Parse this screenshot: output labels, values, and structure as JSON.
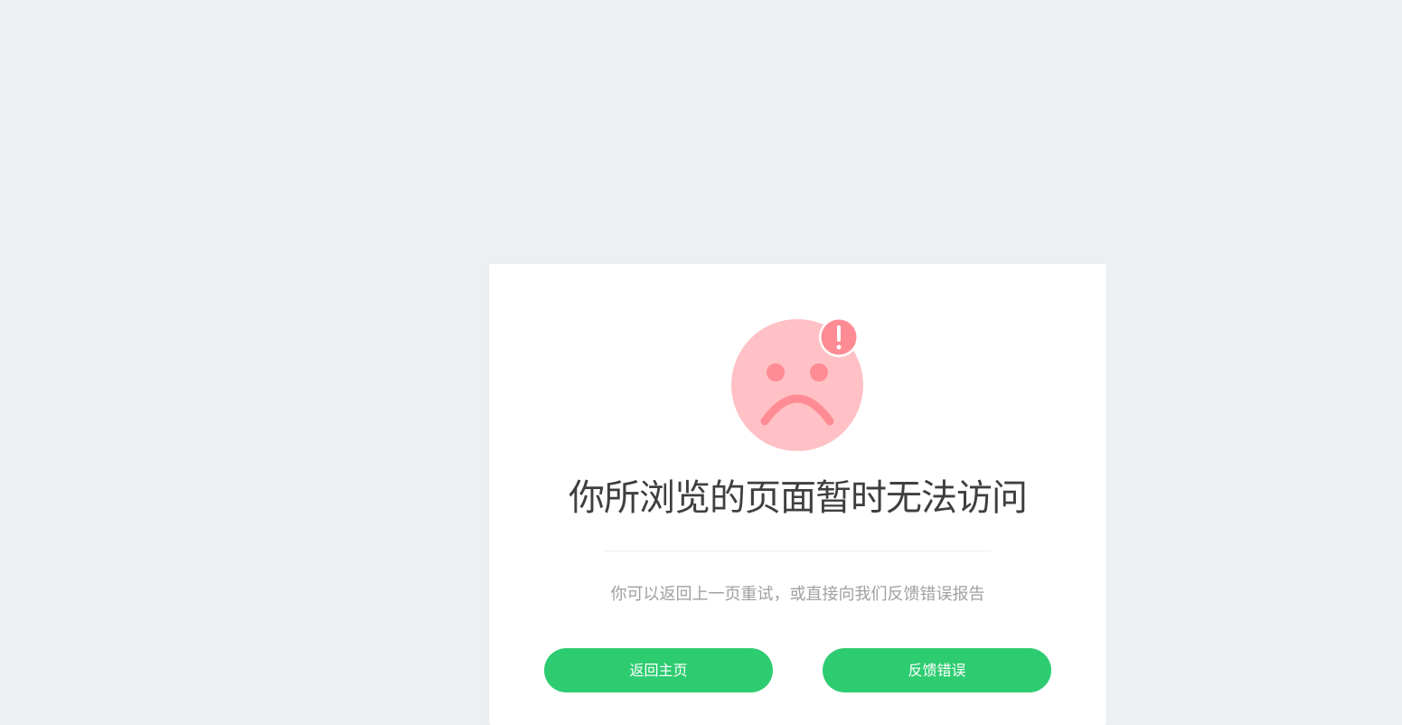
{
  "error": {
    "title": "你所浏览的页面暂时无法访问",
    "subtitle": "你可以返回上一页重试，或直接向我们反馈错误报告",
    "icon": "sad-face-icon",
    "badge_icon": "exclamation-icon"
  },
  "actions": {
    "home_label": "返回主页",
    "feedback_label": "反馈错误"
  },
  "colors": {
    "background": "#ecf0f3",
    "face": "#ffc1c5",
    "face_features": "#ff8c94",
    "badge": "#ff8c94",
    "button": "#2ecc71"
  }
}
